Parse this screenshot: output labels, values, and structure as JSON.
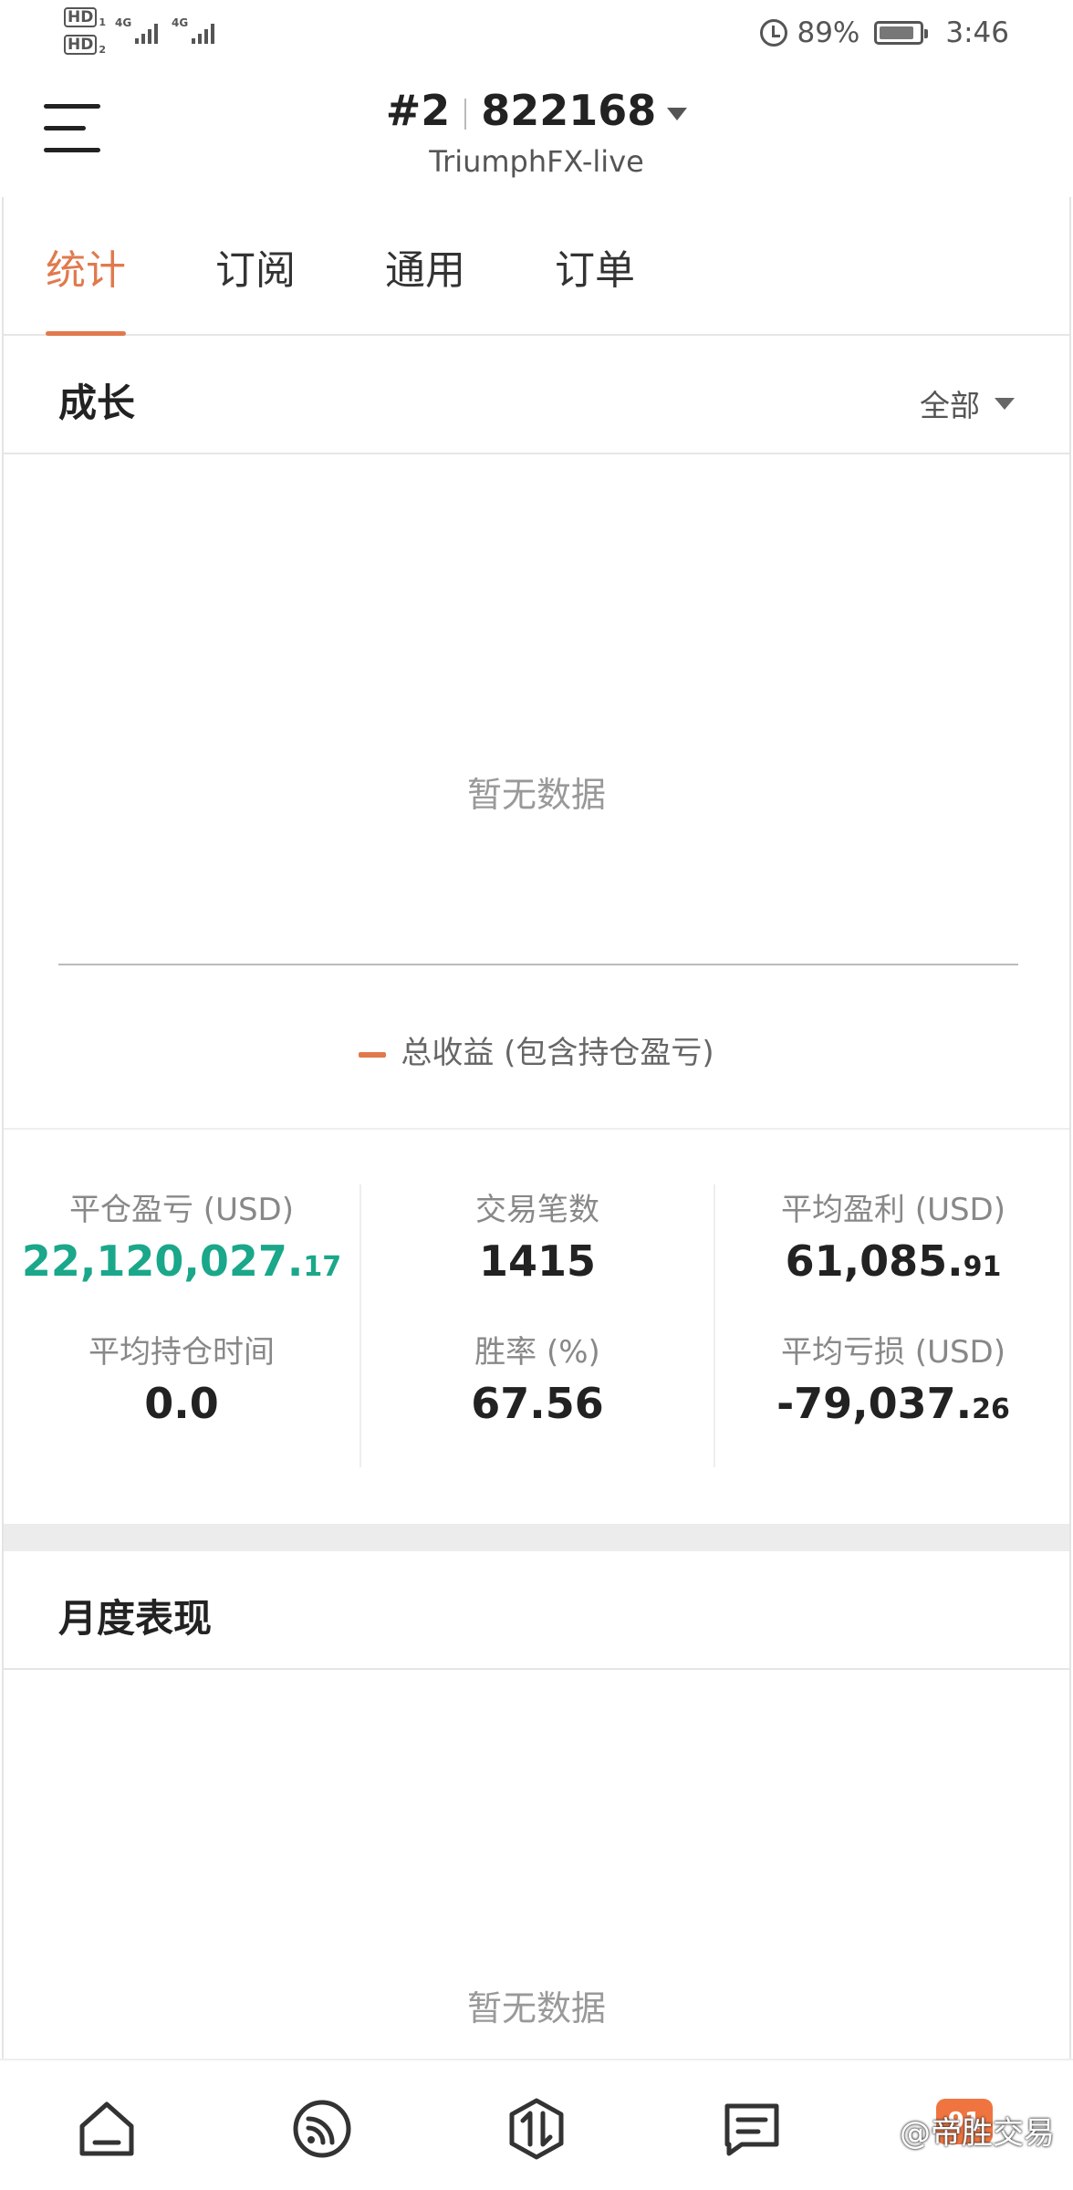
{
  "status_bar": {
    "hd1": "HD",
    "hd1_sub": "1",
    "hd2": "HD",
    "hd2_sub": "2",
    "net1": "4G",
    "net2": "4G",
    "battery_percent": "89%",
    "time": "3:46"
  },
  "header": {
    "account_index": "#2",
    "account_number": "822168",
    "server": "TriumphFX-live"
  },
  "tabs": [
    {
      "label": "统计",
      "active": true
    },
    {
      "label": "订阅",
      "active": false
    },
    {
      "label": "通用",
      "active": false
    },
    {
      "label": "订单",
      "active": false
    }
  ],
  "growth": {
    "title": "成长",
    "filter": "全部",
    "empty_text": "暂无数据",
    "legend": "总收益 (包含持仓盈亏)"
  },
  "stats": {
    "closed_pnl": {
      "label": "平仓盈亏 (USD)",
      "main": "22,120,027.",
      "dec": "17"
    },
    "trades": {
      "label": "交易笔数",
      "main": "1415",
      "dec": ""
    },
    "avg_profit": {
      "label": "平均盈利 (USD)",
      "main": "61,085.",
      "dec": "91"
    },
    "avg_hold_time": {
      "label": "平均持仓时间",
      "main": "0.0",
      "dec": ""
    },
    "win_rate": {
      "label": "胜率 (%)",
      "main": "67.56",
      "dec": ""
    },
    "avg_loss": {
      "label": "平均亏损 (USD)",
      "main": "-79,037.",
      "dec": "26"
    }
  },
  "monthly": {
    "title": "月度表现",
    "empty_text": "暂无数据"
  },
  "bottom_nav": [
    {
      "icon": "home-icon"
    },
    {
      "icon": "signal-feed-icon"
    },
    {
      "icon": "trade-exchange-icon"
    },
    {
      "icon": "message-icon"
    }
  ],
  "watermark": "@帝胜交易",
  "badge_text": "91"
}
